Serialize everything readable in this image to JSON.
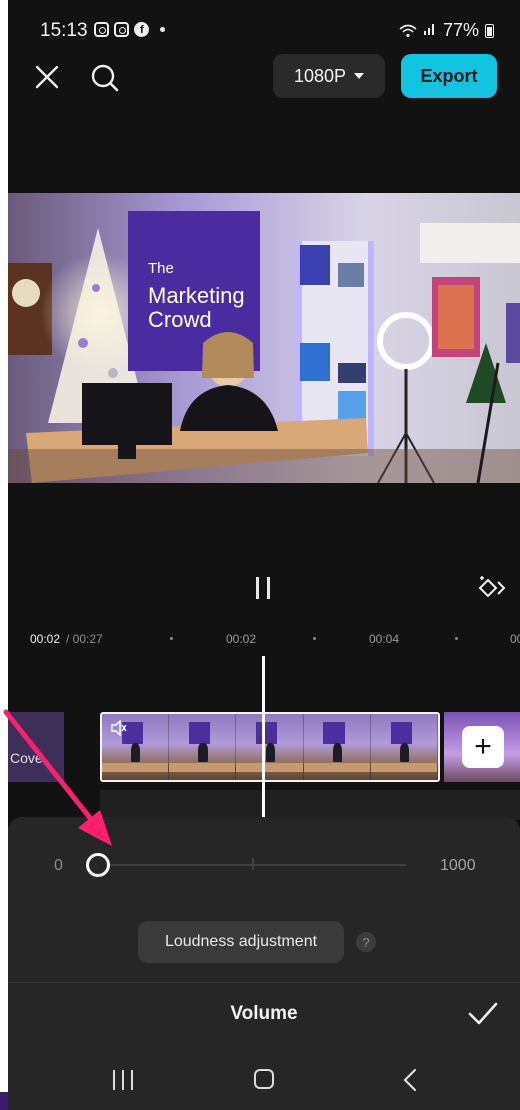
{
  "status_bar": {
    "time": "15:13",
    "notification_icons": [
      "instagram-icon",
      "instagram-icon",
      "facebook-icon"
    ],
    "battery": "77%"
  },
  "toolbar": {
    "resolution": "1080P",
    "export_label": "Export"
  },
  "preview": {
    "poster_lines": [
      "The",
      "Marketing",
      "Crowd"
    ]
  },
  "timeline": {
    "current_time": "00:02",
    "total_time": "/ 00:27",
    "tick_labels": [
      "00:02",
      "00:04",
      "00"
    ],
    "cover_label": "Cove",
    "playhead_color": "#fafafa"
  },
  "volume_panel": {
    "min_label": "0",
    "max_label": "1000",
    "value": 0,
    "loudness_label": "Loudness adjustment",
    "help_label": "?",
    "title": "Volume"
  },
  "colors": {
    "accent": "#13c4e0",
    "background": "#121212",
    "panel": "#262626",
    "annotation_arrow": "#ff1f6e"
  },
  "icons": {
    "close": "close-icon",
    "search": "search-icon",
    "keyframe": "keyframe-icon",
    "mute": "mute-icon",
    "add": "plus-icon",
    "confirm": "check-icon"
  }
}
